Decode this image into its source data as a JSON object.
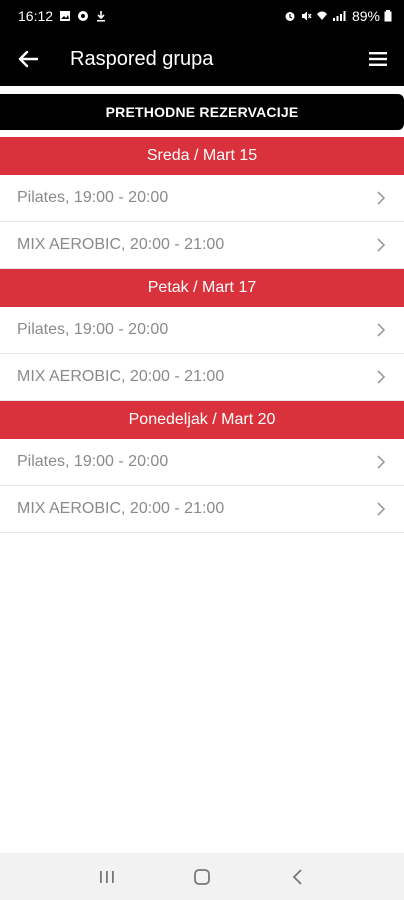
{
  "status_bar": {
    "time": "16:12",
    "battery": "89%"
  },
  "app_bar": {
    "title": "Raspored grupa"
  },
  "prev_button": {
    "label": "PRETHODNE REZERVACIJE"
  },
  "days": [
    {
      "header": "Sreda / Mart 15",
      "classes": [
        "Pilates, 19:00 - 20:00",
        "MIX AEROBIC, 20:00 - 21:00"
      ]
    },
    {
      "header": "Petak / Mart 17",
      "classes": [
        "Pilates, 19:00 - 20:00",
        "MIX AEROBIC, 20:00 - 21:00"
      ]
    },
    {
      "header": "Ponedeljak / Mart 20",
      "classes": [
        "Pilates, 19:00 - 20:00",
        "MIX AEROBIC, 20:00 - 21:00"
      ]
    }
  ],
  "colors": {
    "accent": "#d9323c",
    "bar": "#000000",
    "row_text": "#8a8a8a"
  },
  "icons": {
    "back": "arrow-left-icon",
    "menu": "hamburger-menu-icon",
    "row": "chevron-right-icon",
    "nav": [
      "recent-apps-icon",
      "home-icon",
      "back-nav-icon"
    ]
  }
}
